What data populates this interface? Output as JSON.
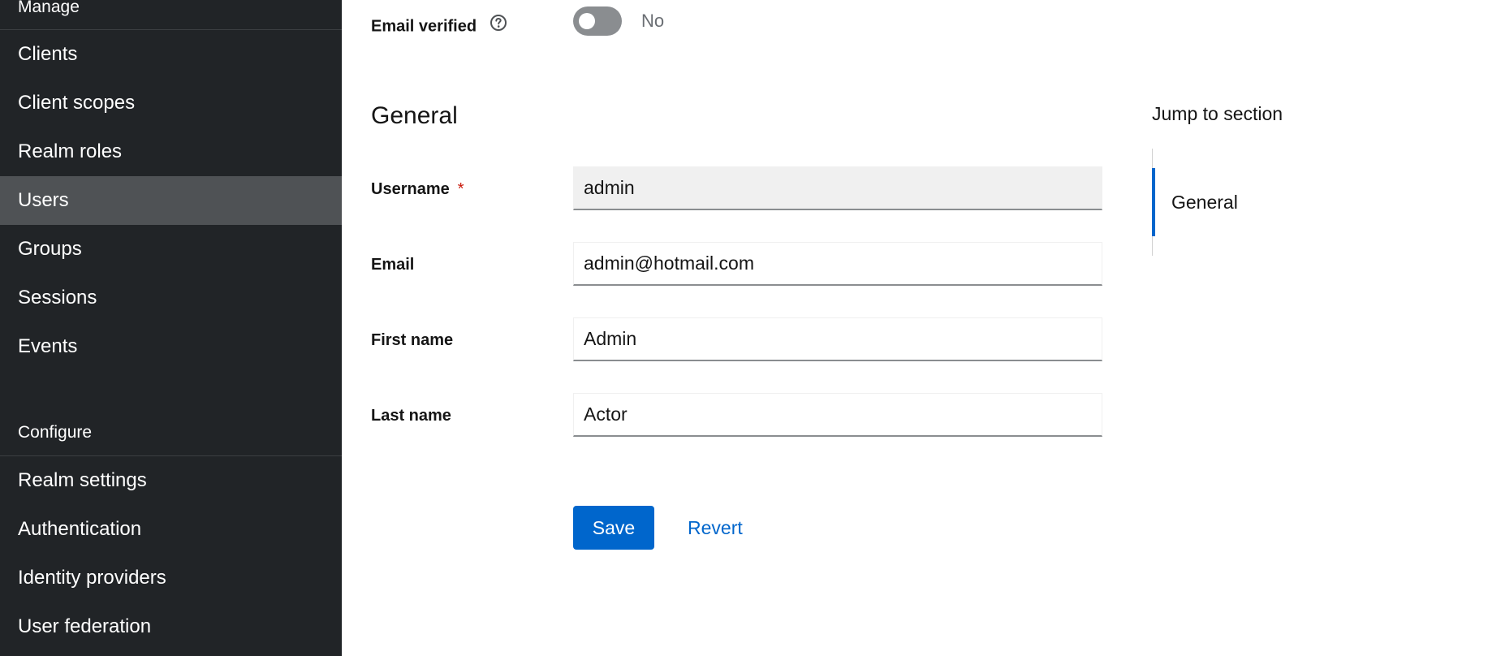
{
  "sidebar": {
    "manage_title": "Manage",
    "manage_items": [
      {
        "label": "Clients"
      },
      {
        "label": "Client scopes"
      },
      {
        "label": "Realm roles"
      },
      {
        "label": "Users",
        "active": true
      },
      {
        "label": "Groups"
      },
      {
        "label": "Sessions"
      },
      {
        "label": "Events"
      }
    ],
    "configure_title": "Configure",
    "configure_items": [
      {
        "label": "Realm settings"
      },
      {
        "label": "Authentication"
      },
      {
        "label": "Identity providers"
      },
      {
        "label": "User federation"
      }
    ]
  },
  "form": {
    "email_verified": {
      "label": "Email verified",
      "help_icon": "question-circle-icon",
      "value": false,
      "state_text": "No"
    },
    "section_title": "General",
    "username": {
      "label": "Username",
      "required_marker": "*",
      "value": "admin",
      "readonly": true
    },
    "email": {
      "label": "Email",
      "value": "admin@hotmail.com"
    },
    "first_name": {
      "label": "First name",
      "value": "Admin"
    },
    "last_name": {
      "label": "Last name",
      "value": "Actor"
    },
    "save_label": "Save",
    "revert_label": "Revert"
  },
  "jump_to_section": {
    "title": "Jump to section",
    "items": [
      {
        "label": "General",
        "active": true
      }
    ]
  },
  "colors": {
    "sidebar_bg": "#212427",
    "sidebar_active": "#4f5255",
    "primary": "#0066cc",
    "required": "#c9190b",
    "toggle_off": "#8a8d90"
  }
}
